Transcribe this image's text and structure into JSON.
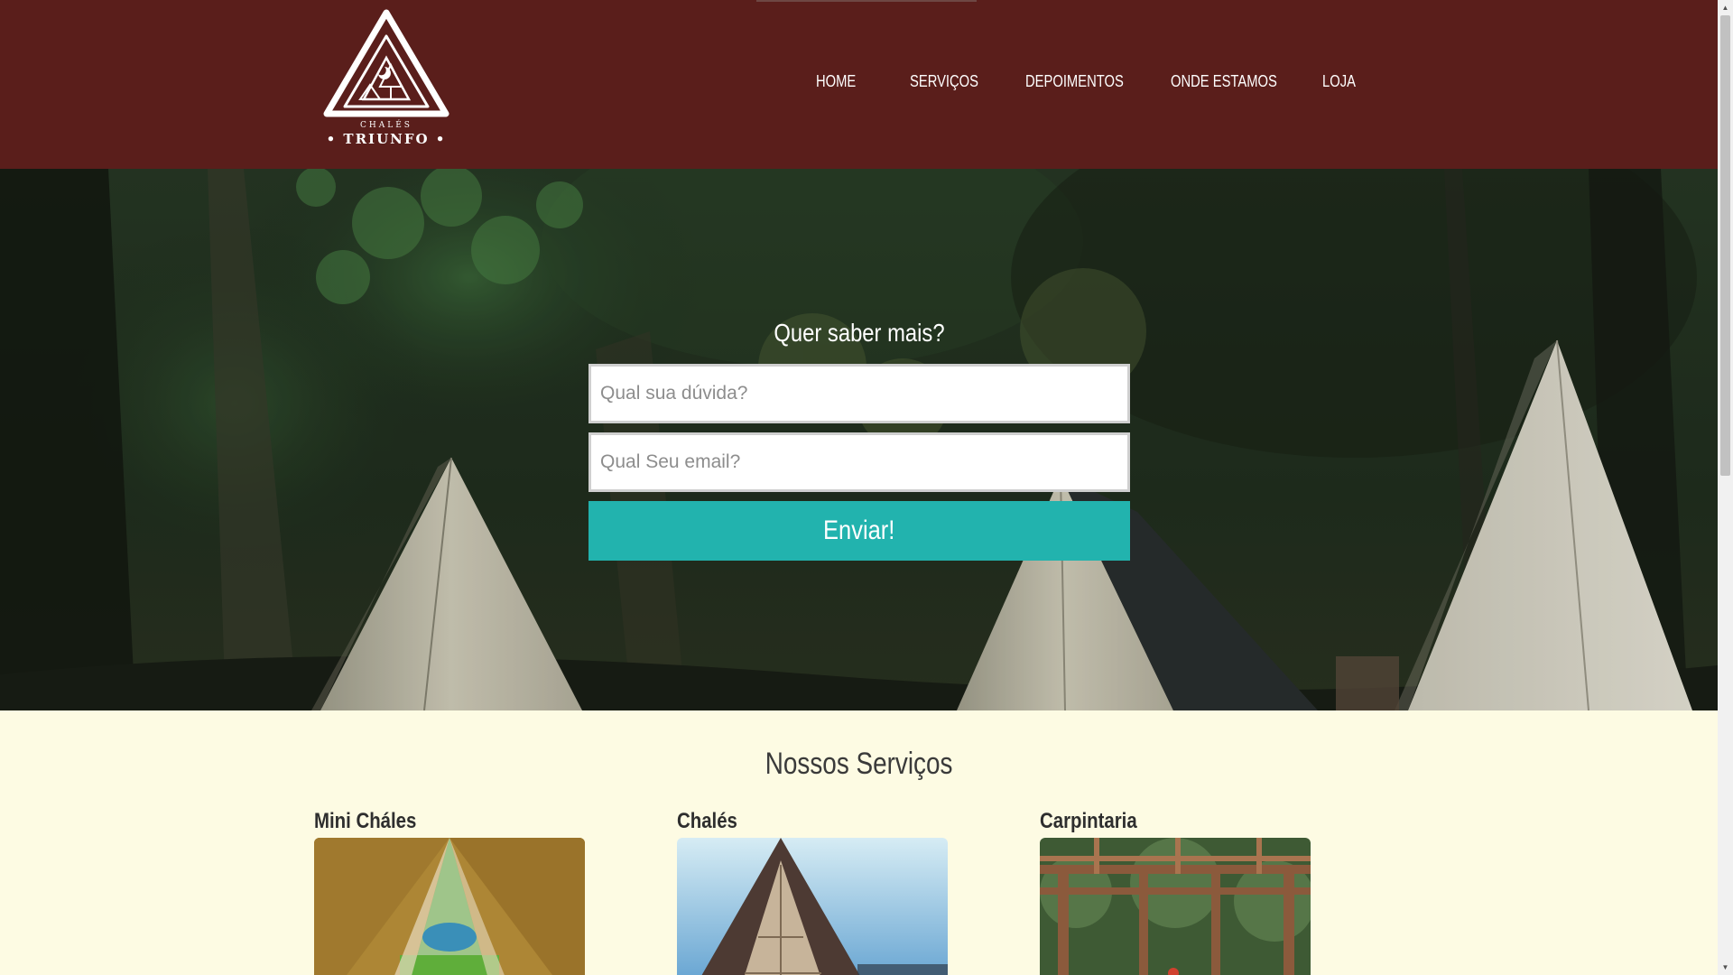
{
  "header": {
    "logo": {
      "subtitle": "CHALÉS",
      "name": "• TRIUNFO •"
    },
    "nav": [
      {
        "label": "HOME"
      },
      {
        "label": "SERVIÇOS"
      },
      {
        "label": "DEPOIMENTOS"
      },
      {
        "label": "ONDE ESTAMOS"
      },
      {
        "label": "LOJA"
      }
    ]
  },
  "contact_form": {
    "title": "Quer saber mais?",
    "question_placeholder": "Qual sua dúvida?",
    "email_placeholder": "Qual Seu email?",
    "submit_label": "Enviar!"
  },
  "services": {
    "title": "Nossos Serviços",
    "items": [
      {
        "title": "Mini Cháles"
      },
      {
        "title": "Chalés"
      },
      {
        "title": "Carpintaria"
      }
    ]
  },
  "colors": {
    "header_bg": "#5a1e1b",
    "accent": "#22b3ae",
    "page_bg": "#fdfbe3"
  }
}
